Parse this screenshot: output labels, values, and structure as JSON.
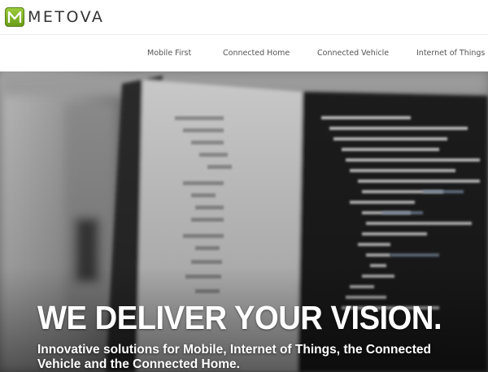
{
  "header": {
    "brand": "METOVA",
    "logo_icon": "metova-m-logo-icon",
    "brand_color": "#7cb32a"
  },
  "nav": {
    "items": [
      {
        "label": "Mobile First"
      },
      {
        "label": "Connected Home"
      },
      {
        "label": "Connected Vehicle"
      },
      {
        "label": "Internet of Things"
      }
    ]
  },
  "hero": {
    "headline": "WE DELIVER YOUR VISION.",
    "subtext": "Innovative solutions for Mobile, Internet of Things, the Connected Vehicle and the Connected Home.",
    "background": "blurred-code-on-monitor-image"
  }
}
